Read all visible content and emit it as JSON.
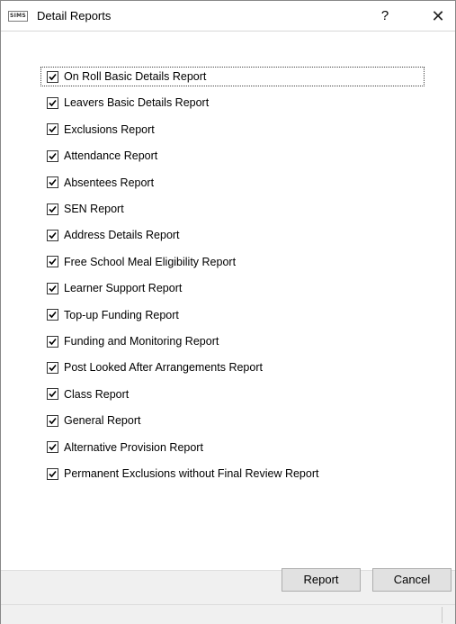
{
  "window": {
    "icon_text": "SIMS",
    "title": "Detail Reports",
    "help_label": "?",
    "close_label": "✕"
  },
  "reports": [
    {
      "label": "On Roll Basic Details Report",
      "checked": true
    },
    {
      "label": "Leavers Basic Details Report",
      "checked": true
    },
    {
      "label": "Exclusions Report",
      "checked": true
    },
    {
      "label": "Attendance Report",
      "checked": true
    },
    {
      "label": "Absentees Report",
      "checked": true
    },
    {
      "label": "SEN Report",
      "checked": true
    },
    {
      "label": "Address Details Report",
      "checked": true
    },
    {
      "label": "Free School Meal Eligibility Report",
      "checked": true
    },
    {
      "label": "Learner Support Report",
      "checked": true
    },
    {
      "label": "Top-up Funding Report",
      "checked": true
    },
    {
      "label": "Funding and Monitoring Report",
      "checked": true
    },
    {
      "label": "Post Looked After Arrangements Report",
      "checked": true
    },
    {
      "label": "Class Report",
      "checked": true
    },
    {
      "label": "General Report",
      "checked": true
    },
    {
      "label": "Alternative Provision Report",
      "checked": true
    },
    {
      "label": "Permanent Exclusions without Final Review Report",
      "checked": true
    }
  ],
  "buttons": {
    "report": "Report",
    "cancel": "Cancel"
  }
}
